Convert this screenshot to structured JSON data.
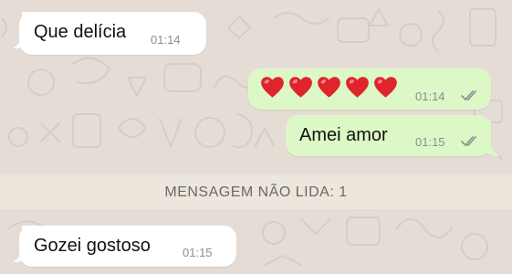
{
  "chat": {
    "messages": [
      {
        "direction": "incoming",
        "text": "Que delícia",
        "time": "01:14"
      },
      {
        "direction": "outgoing",
        "emoji": [
          "❤️",
          "❤️",
          "❤️",
          "❤️",
          "❤️"
        ],
        "time": "01:14",
        "status": "read"
      },
      {
        "direction": "outgoing",
        "text": "Amei amor",
        "time": "01:15",
        "status": "read"
      },
      {
        "direction": "incoming",
        "text": "Gozei gostoso",
        "time": "01:15"
      }
    ],
    "unread_banner": "MENSAGEM NÃO LIDA: 1"
  },
  "colors": {
    "wallpaper": "#e5ddd5",
    "incoming_bubble": "#ffffff",
    "outgoing_bubble": "#dcf8c6",
    "heart": "#e0242c",
    "read_ticks": "#8a8f8c"
  },
  "icons": [
    "heart-emoji",
    "double-check-icon"
  ]
}
